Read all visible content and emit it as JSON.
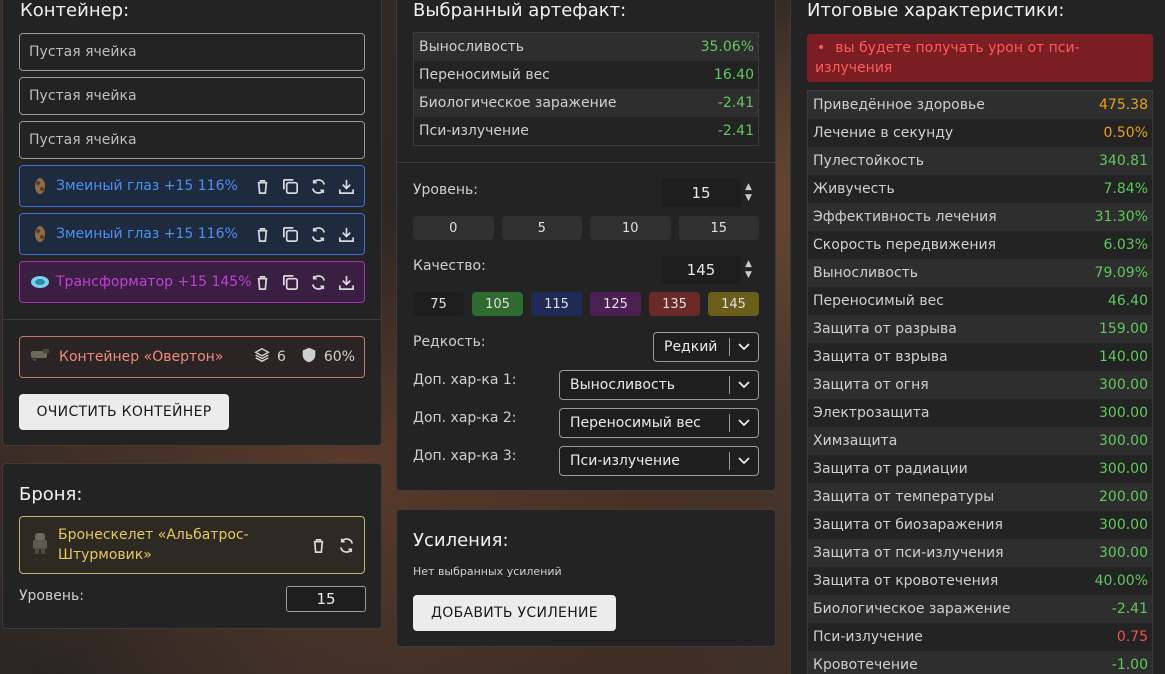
{
  "container": {
    "title": "Контейнер:",
    "empty_slots": [
      "Пустая ячейка",
      "Пустая ячейка",
      "Пустая ячейка"
    ],
    "artifacts": [
      {
        "name": "Змеиный глаз +15 116%",
        "color": "#4f8ff0"
      },
      {
        "name": "Змеиный глаз +15 116%",
        "color": "#4f8ff0"
      },
      {
        "name": "Трансформатор +15 145%",
        "color": "#c040d8"
      }
    ],
    "item": {
      "name": "Контейнер «Овертон»",
      "slots": "6",
      "protection": "60%"
    },
    "clear_button": "ОЧИСТИТЬ КОНТЕЙНЕР"
  },
  "armor": {
    "title": "Броня:",
    "item_name": "Бронескелет «Альбатрос-Штурмовик»",
    "level_label": "Уровень:",
    "level_value": "15"
  },
  "artifact": {
    "title": "Выбранный артефакт:",
    "stats": [
      {
        "k": "Выносливость",
        "v": "35.06%"
      },
      {
        "k": "Переносимый вес",
        "v": "16.40"
      },
      {
        "k": "Биологическое заражение",
        "v": "-2.41"
      },
      {
        "k": "Пси-излучение",
        "v": "-2.41"
      }
    ],
    "level_label": "Уровень:",
    "level_value": "15",
    "level_presets": [
      "0",
      "5",
      "10",
      "15"
    ],
    "quality_label": "Качество:",
    "quality_value": "145",
    "quality_presets": [
      {
        "label": "75",
        "bg": "#1e1e1e"
      },
      {
        "label": "105",
        "bg": "#2f6a2f"
      },
      {
        "label": "115",
        "bg": "#1f2a55"
      },
      {
        "label": "125",
        "bg": "#4a2055"
      },
      {
        "label": "135",
        "bg": "#6a2a2a"
      },
      {
        "label": "145",
        "bg": "#6a5e1a"
      }
    ],
    "rarity_label": "Редкость:",
    "rarity_value": "Редкий",
    "extra1_label": "Доп. хар-ка 1:",
    "extra1_value": "Выносливость",
    "extra2_label": "Доп. хар-ка 2:",
    "extra2_value": "Переносимый вес",
    "extra3_label": "Доп. хар-ка 3:",
    "extra3_value": "Пси-излучение"
  },
  "boosts": {
    "title": "Усиления:",
    "empty_note": "Нет выбранных усилений",
    "add_button": "ДОБАВИТЬ УСИЛЕНИЕ"
  },
  "totals": {
    "title": "Итоговые характеристики:",
    "warning": "вы будете получать урон от пси-излучения",
    "stats": [
      {
        "k": "Приведённое здоровье",
        "v": "475.38",
        "c": "orange"
      },
      {
        "k": "Лечение в секунду",
        "v": "0.50%",
        "c": "orange"
      },
      {
        "k": "Пулестойкость",
        "v": "340.81",
        "c": "green"
      },
      {
        "k": "Живучесть",
        "v": "7.84%",
        "c": "green"
      },
      {
        "k": "Эффективность лечения",
        "v": "31.30%",
        "c": "green"
      },
      {
        "k": "Скорость передвижения",
        "v": "6.03%",
        "c": "green"
      },
      {
        "k": "Выносливость",
        "v": "79.09%",
        "c": "green"
      },
      {
        "k": "Переносимый вес",
        "v": "46.40",
        "c": "green"
      },
      {
        "k": "Защита от разрыва",
        "v": "159.00",
        "c": "green"
      },
      {
        "k": "Защита от взрыва",
        "v": "140.00",
        "c": "green"
      },
      {
        "k": "Защита от огня",
        "v": "300.00",
        "c": "green"
      },
      {
        "k": "Электрозащита",
        "v": "300.00",
        "c": "green"
      },
      {
        "k": "Химзащита",
        "v": "300.00",
        "c": "green"
      },
      {
        "k": "Защита от радиации",
        "v": "300.00",
        "c": "green"
      },
      {
        "k": "Защита от температуры",
        "v": "200.00",
        "c": "green"
      },
      {
        "k": "Защита от биозаражения",
        "v": "300.00",
        "c": "green"
      },
      {
        "k": "Защита от пси-излучения",
        "v": "300.00",
        "c": "green"
      },
      {
        "k": "Защита от кровотечения",
        "v": "40.00%",
        "c": "green"
      },
      {
        "k": "Биологическое заражение",
        "v": "-2.41",
        "c": "green"
      },
      {
        "k": "Пси-излучение",
        "v": "0.75",
        "c": "red"
      },
      {
        "k": "Кровотечение",
        "v": "-1.00",
        "c": "green"
      }
    ]
  }
}
